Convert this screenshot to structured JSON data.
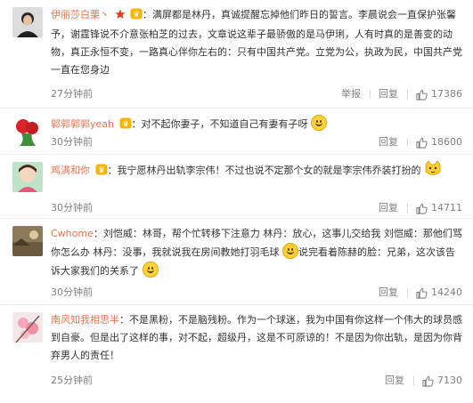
{
  "comments": [
    {
      "name": "伊丽莎白栗丶",
      "text": "满屏都是林丹，真诚提醒忘掉他们昨日的誓言。李晨说会一直保护张馨予，谢霆锋说不介意张柏芝的过去，文章说这辈子最骄傲的是马伊琍，人有时真的是善变的动物，真正永恒不变，一路真心伴你左右的：只有中国共产党。立党为公，执政为民，中国共产党一直在您身边",
      "time": "27分钟前",
      "actions": [
        "举报",
        "回复"
      ],
      "likes": "17386",
      "avatar": "avatar-man-portrait"
    },
    {
      "name": "郭郭郭郭yeah",
      "text": "对不起你妻子，不知道自己有妻有子呀",
      "time": "30分钟前",
      "actions": [
        "回复"
      ],
      "likes": "18600",
      "avatar": "avatar-red-flowers"
    },
    {
      "name": "鸡满和你",
      "text": "我宁愿林丹出轨李宗伟！不过也说不定那个女的就是李宗伟乔装打扮的",
      "time": "30分钟前",
      "actions": [
        "回复"
      ],
      "likes": "14711",
      "avatar": "avatar-anime-girl"
    },
    {
      "name": "Cwhome",
      "text_a": "刘恺威：林哥，帮个忙转移下注意力 林丹：放心，这事儿交给我 刘恺威：那他们骂你怎么办 林丹：没事，我就说我在房间教她打羽毛球",
      "text_b": "说完看着陈赫的脸：兄弟，这次该告诉大家我们的关系了",
      "time": "30分钟前",
      "actions": [
        "回复"
      ],
      "likes": "14240",
      "avatar": "avatar-landscape"
    },
    {
      "name": "南风知我相思半",
      "text": "不是黑粉，不是脑残粉。作为一个球迷，我为中国有你这样一个伟大的球员感到自豪。但是出了这样的事，对不起，超级丹，这是不可原谅的！不是因为你出轨，是因为你背弃男人的责任！",
      "time": "25分钟前",
      "actions": [
        "回复"
      ],
      "likes": "7130",
      "avatar": "avatar-pink-blossom"
    }
  ],
  "colors": {
    "name": "#eb7350",
    "meta": "#808080",
    "text": "#333333"
  }
}
